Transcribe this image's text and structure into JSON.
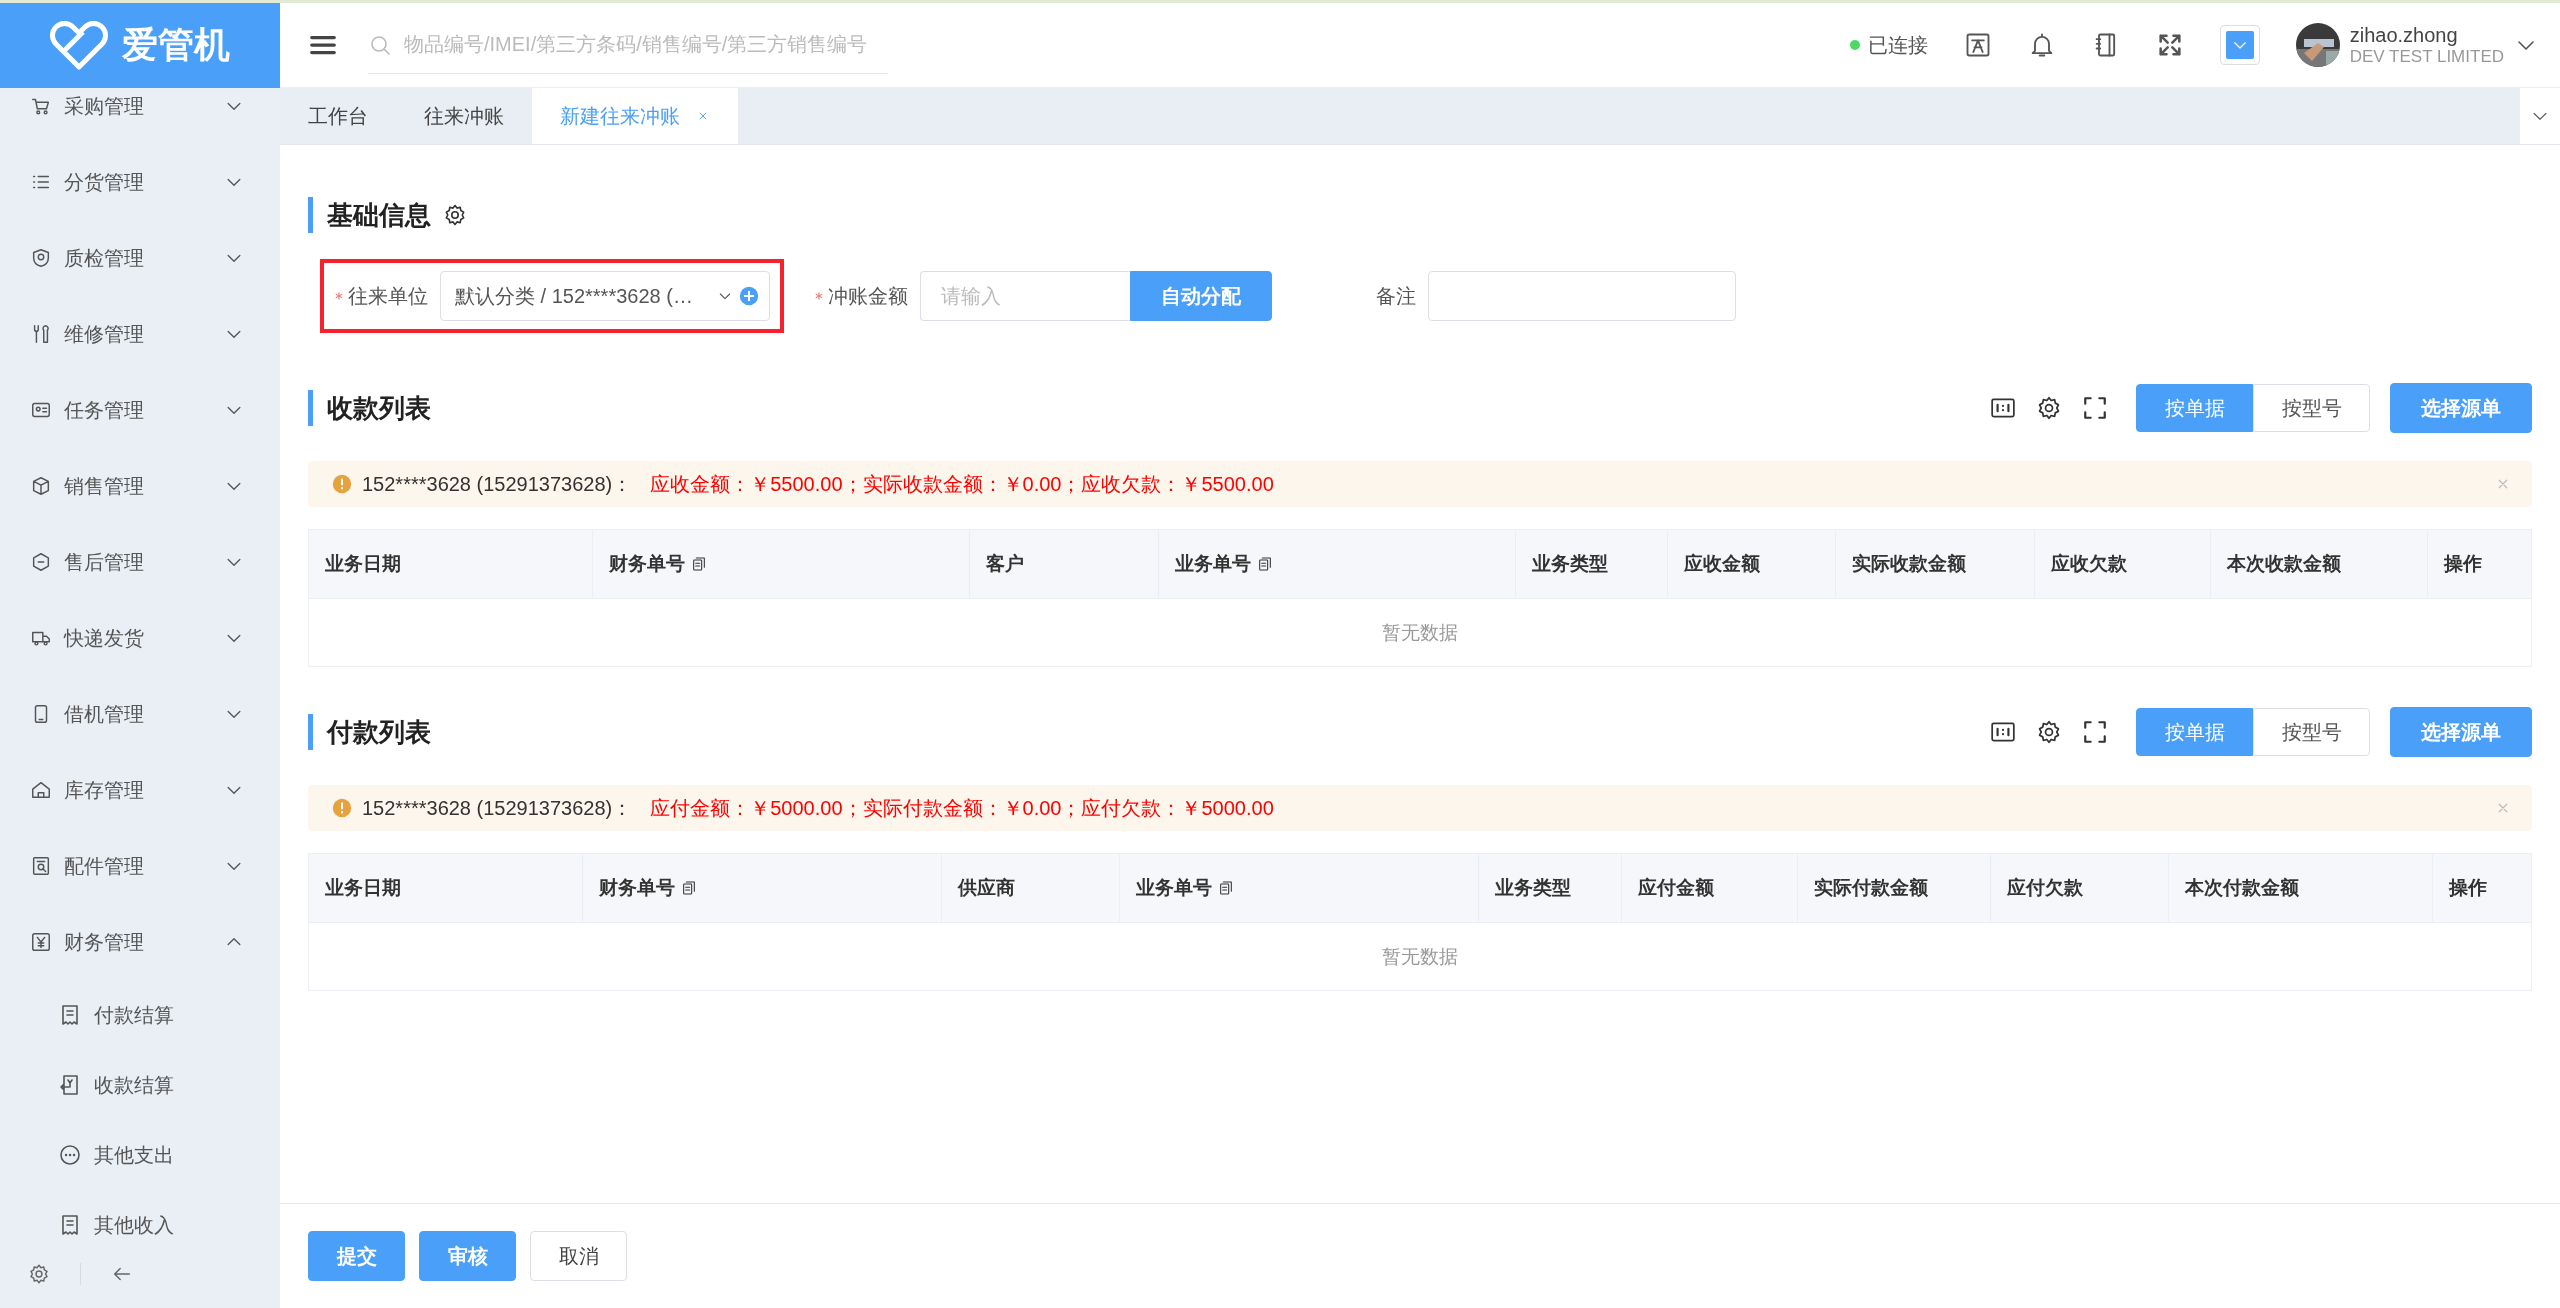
{
  "sidebar": {
    "logo": "爱管机",
    "items": [
      {
        "label": "采购管理",
        "expanded": false
      },
      {
        "label": "分货管理",
        "expanded": false
      },
      {
        "label": "质检管理",
        "expanded": false
      },
      {
        "label": "维修管理",
        "expanded": false
      },
      {
        "label": "任务管理",
        "expanded": false
      },
      {
        "label": "销售管理",
        "expanded": false
      },
      {
        "label": "售后管理",
        "expanded": false
      },
      {
        "label": "快递发货",
        "expanded": false
      },
      {
        "label": "借机管理",
        "expanded": false
      },
      {
        "label": "库存管理",
        "expanded": false
      },
      {
        "label": "配件管理",
        "expanded": false
      },
      {
        "label": "财务管理",
        "expanded": true,
        "children": [
          {
            "label": "付款结算"
          },
          {
            "label": "收款结算"
          },
          {
            "label": "其他支出"
          },
          {
            "label": "其他收入"
          }
        ]
      }
    ]
  },
  "header": {
    "search": {
      "placeholder": "物品编号/IMEI/第三方条码/销售编号/第三方销售编号"
    },
    "status": "已连接",
    "user": {
      "name": "zihao.zhong",
      "company": "DEV TEST LIMITED"
    }
  },
  "tabs": [
    {
      "label": "工作台",
      "selected": false,
      "closable": false
    },
    {
      "label": "往来冲账",
      "selected": false,
      "closable": false
    },
    {
      "label": "新建往来冲账",
      "selected": true,
      "closable": true
    }
  ],
  "basic_info": {
    "title": "基础信息",
    "fields": [
      {
        "kind": "select",
        "label": "往来单位",
        "required": true,
        "highlighted": true,
        "value": "默认分类 / 152****3628 (…"
      },
      {
        "kind": "amount",
        "label": "冲账金额",
        "required": true,
        "highlighted": false,
        "placeholder": "请输入",
        "button": "自动分配"
      },
      {
        "kind": "text",
        "label": "备注",
        "required": false,
        "highlighted": false
      }
    ]
  },
  "sections": [
    {
      "title": "收款列表",
      "view_options": [
        {
          "label": "按单据",
          "selected": true
        },
        {
          "label": "按型号",
          "selected": false
        }
      ],
      "action": "选择源单",
      "alert": {
        "party": "152****3628 (15291373628)：",
        "summary": "应收金额：￥5500.00；实际收款金额：￥0.00；应收欠款：￥5500.00"
      },
      "columns": [
        {
          "label": "业务日期",
          "copyable": false
        },
        {
          "label": "财务单号",
          "copyable": true
        },
        {
          "label": "客户",
          "copyable": false
        },
        {
          "label": "业务单号",
          "copyable": true
        },
        {
          "label": "业务类型",
          "copyable": false
        },
        {
          "label": "应收金额",
          "copyable": false
        },
        {
          "label": "实际收款金额",
          "copyable": false
        },
        {
          "label": "应收欠款",
          "copyable": false
        },
        {
          "label": "本次收款金额",
          "copyable": false
        },
        {
          "label": "操作",
          "copyable": false
        }
      ],
      "empty_text": "暂无数据"
    },
    {
      "title": "付款列表",
      "view_options": [
        {
          "label": "按单据",
          "selected": true
        },
        {
          "label": "按型号",
          "selected": false
        }
      ],
      "action": "选择源单",
      "alert": {
        "party": "152****3628 (15291373628)：",
        "summary": "应付金额：￥5000.00；实际付款金额：￥0.00；应付欠款：￥5000.00"
      },
      "columns": [
        {
          "label": "业务日期",
          "copyable": false
        },
        {
          "label": "财务单号",
          "copyable": true
        },
        {
          "label": "供应商",
          "copyable": false
        },
        {
          "label": "业务单号",
          "copyable": true
        },
        {
          "label": "业务类型",
          "copyable": false
        },
        {
          "label": "应付金额",
          "copyable": false
        },
        {
          "label": "实际付款金额",
          "copyable": false
        },
        {
          "label": "应付欠款",
          "copyable": false
        },
        {
          "label": "本次付款金额",
          "copyable": false
        },
        {
          "label": "操作",
          "copyable": false
        }
      ],
      "empty_text": "暂无数据"
    }
  ],
  "footer": {
    "buttons": [
      {
        "label": "提交",
        "kind": "primary"
      },
      {
        "label": "审核",
        "kind": "primary"
      },
      {
        "label": "取消",
        "kind": "default"
      }
    ]
  }
}
